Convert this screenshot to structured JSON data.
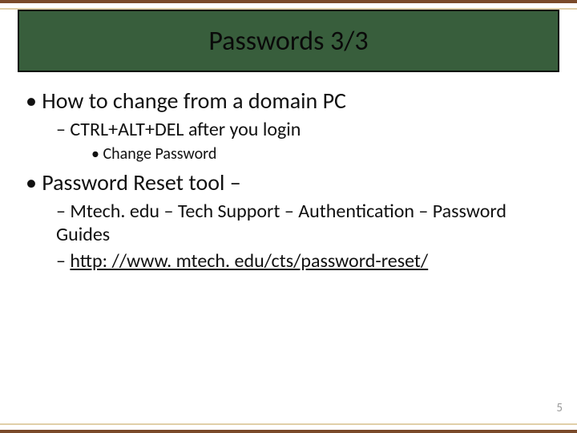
{
  "title": "Passwords 3/3",
  "bullets": {
    "b1": "How to change from a domain PC",
    "b1_1": "CTRL+ALT+DEL after you login",
    "b1_1_1": "Change Password",
    "b2": "Password Reset tool –",
    "b2_1": "Mtech. edu – Tech Support – Authentication – Password Guides",
    "b2_2": "http: //www. mtech. edu/cts/password-reset/"
  },
  "page_number": "5"
}
